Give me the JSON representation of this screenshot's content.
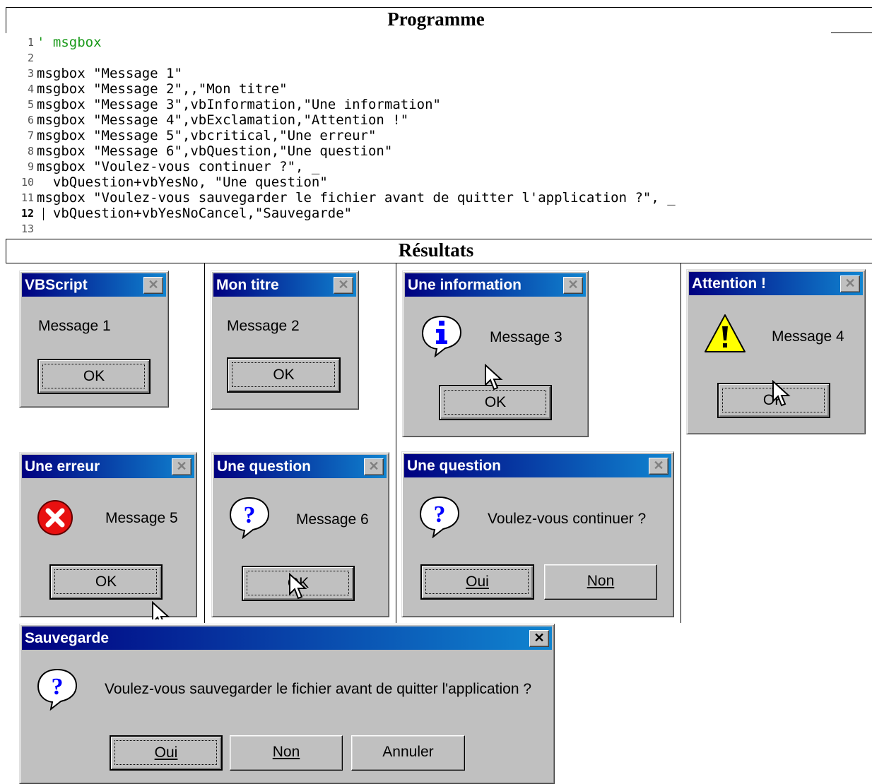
{
  "headings": {
    "program": "Programme",
    "results": "Résultats"
  },
  "code": [
    {
      "n": "1",
      "comment": "' msgbox",
      "text": ""
    },
    {
      "n": "2",
      "text": ""
    },
    {
      "n": "3",
      "text": "msgbox \"Message 1\""
    },
    {
      "n": "4",
      "text": "msgbox \"Message 2\",,\"Mon titre\""
    },
    {
      "n": "5",
      "text": "msgbox \"Message 3\",vbInformation,\"Une information\""
    },
    {
      "n": "6",
      "text": "msgbox \"Message 4\",vbExclamation,\"Attention !\""
    },
    {
      "n": "7",
      "text": "msgbox \"Message 5\",vbcritical,\"Une erreur\""
    },
    {
      "n": "8",
      "text": "msgbox \"Message 6\",vbQuestion,\"Une question\""
    },
    {
      "n": "9",
      "text": "msgbox \"Voulez-vous continuer ?\", _"
    },
    {
      "n": "10",
      "text": "  vbQuestion+vbYesNo, \"Une question\""
    },
    {
      "n": "11",
      "text": "msgbox \"Voulez-vous sauvegarder le fichier avant de quitter l'application ?\", _"
    },
    {
      "n": "12",
      "text": "  vbQuestion+vbYesNoCancel,\"Sauvegarde\""
    },
    {
      "n": "13",
      "text": ""
    }
  ],
  "close_glyph": "✕",
  "dialogs": {
    "d1": {
      "title": "VBScript",
      "message": "Message 1",
      "ok": "OK"
    },
    "d2": {
      "title": "Mon titre",
      "message": "Message 2",
      "ok": "OK"
    },
    "d3": {
      "title": "Une information",
      "message": "Message 3",
      "ok": "OK",
      "icon": "information-icon"
    },
    "d4": {
      "title": "Attention !",
      "message": "Message 4",
      "ok": "OK",
      "icon": "exclamation-icon"
    },
    "d5": {
      "title": "Une erreur",
      "message": "Message 5",
      "ok": "OK",
      "icon": "error-icon"
    },
    "d6": {
      "title": "Une question",
      "message": "Message 6",
      "ok": "OK",
      "icon": "question-icon"
    },
    "d7": {
      "title": "Une question",
      "message": "Voulez-vous continuer ?",
      "yes": "Oui",
      "no": "Non",
      "icon": "question-icon"
    },
    "d8": {
      "title": "Sauvegarde",
      "message": "Voulez-vous sauvegarder le fichier avant de quitter l'application ?",
      "yes": "Oui",
      "no": "Non",
      "cancel": "Annuler",
      "icon": "question-icon"
    }
  },
  "colors": {
    "titlebar_start": "#000080",
    "titlebar_end": "#1084d0",
    "dialog_face": "#c0c0c0",
    "comment": "#1a9a1a"
  }
}
